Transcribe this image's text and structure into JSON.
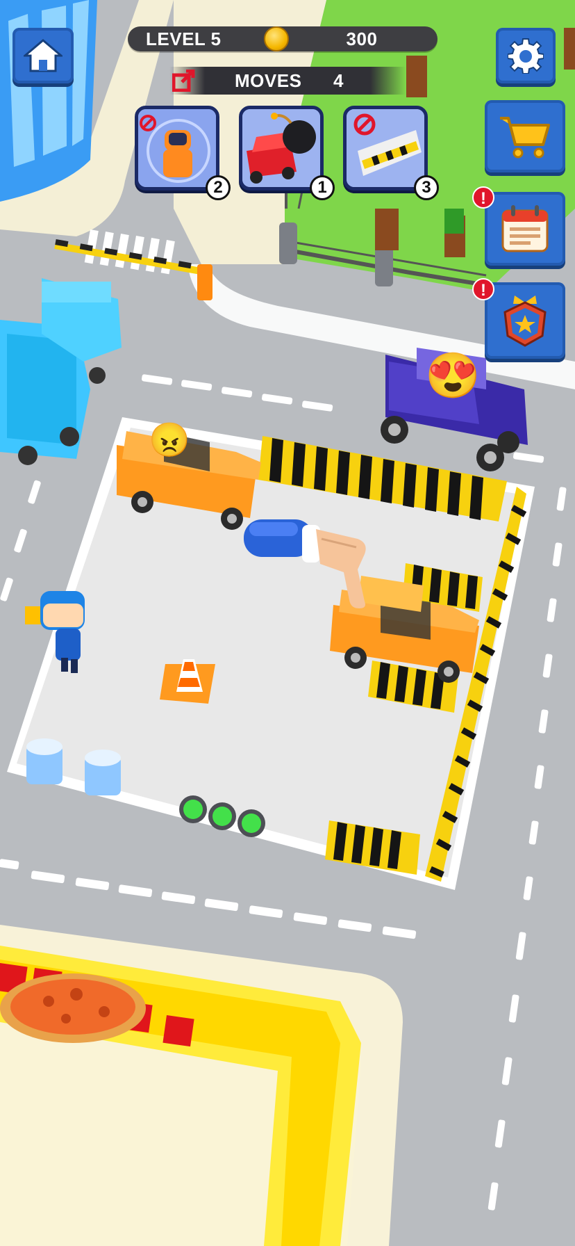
{
  "hud": {
    "level_label": "LEVEL 5",
    "coins": "300",
    "moves_label": "MOVES",
    "moves_value": "4"
  },
  "boosters": [
    {
      "name": "ghost-astronaut",
      "count": "2"
    },
    {
      "name": "car-bomb",
      "count": "1"
    },
    {
      "name": "remove-barrier",
      "count": "3"
    }
  ],
  "side_buttons": [
    "settings",
    "shop",
    "daily-calendar",
    "rank-badge"
  ],
  "alerts": {
    "calendar": "!",
    "rank": "!"
  },
  "colors": {
    "accent_blue": "#2f6fcf",
    "hud_dark": "#3e3e42",
    "taxi_orange": "#ff9a1f",
    "hazard_yellow": "#f7d10f",
    "grass": "#7fd64a",
    "alert_red": "#e0162b"
  },
  "icons": {
    "home": "home-icon",
    "settings": "gear-icon",
    "shop": "cart-icon",
    "calendar": "calendar-icon",
    "rank": "star-badge-icon",
    "exit": "exit-arrow-icon",
    "coin": "coin-icon"
  },
  "emojis": {
    "angry": "😠",
    "love": "😍"
  }
}
